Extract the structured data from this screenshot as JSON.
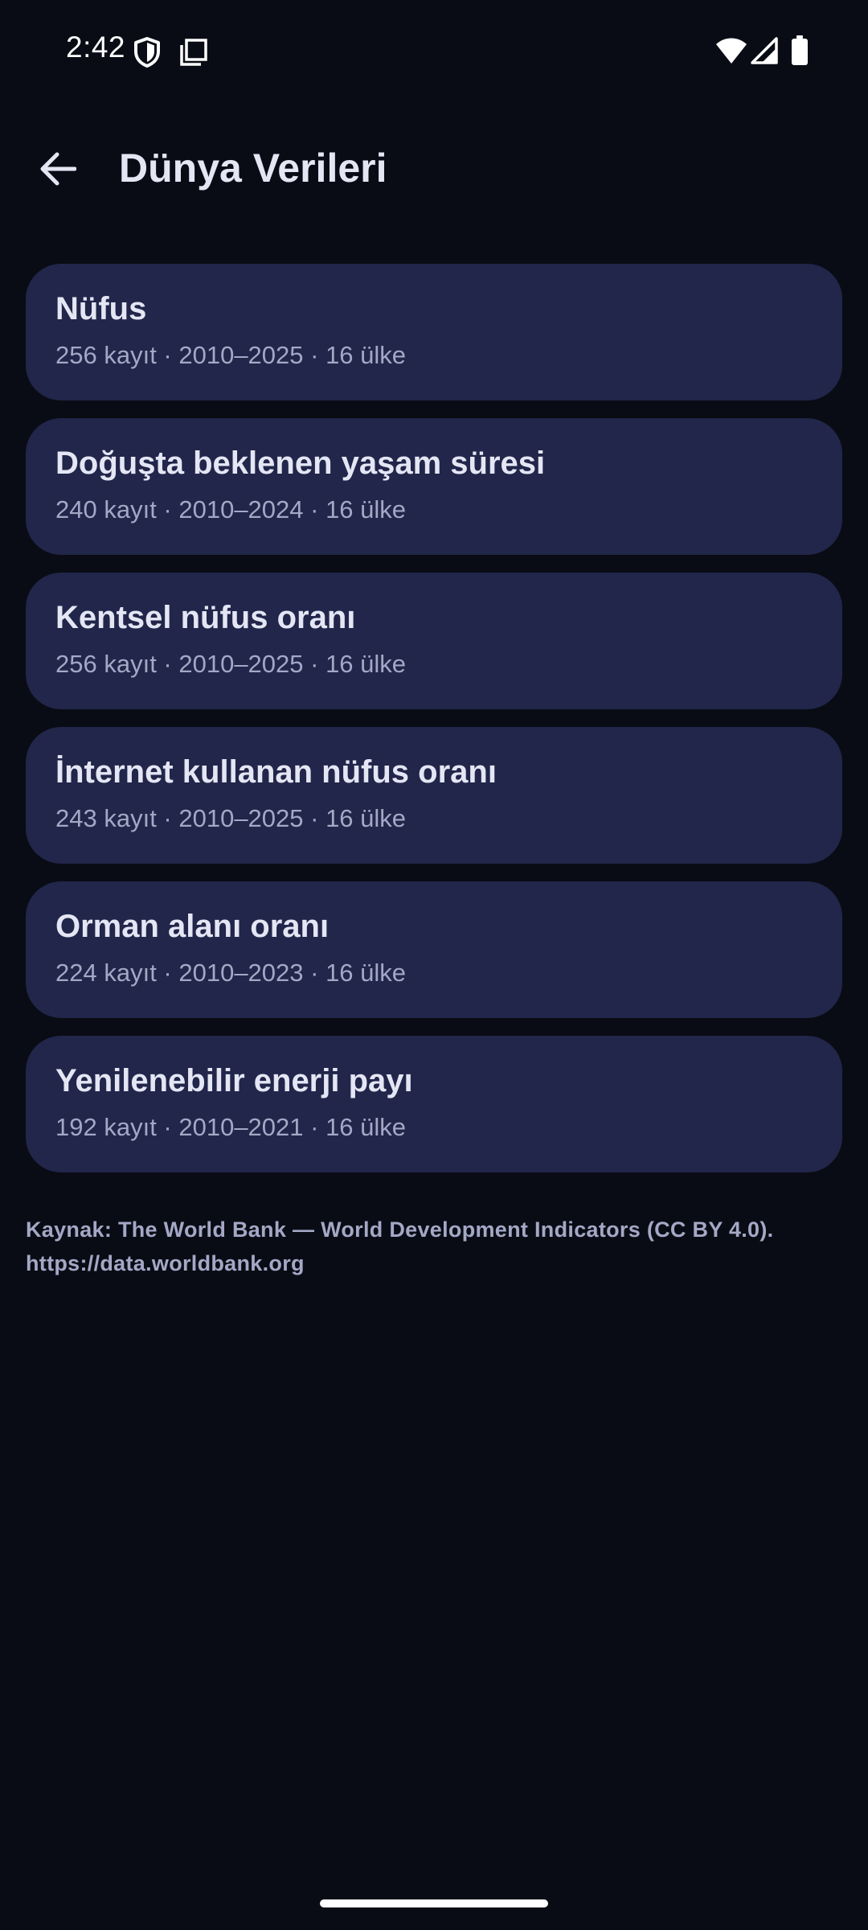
{
  "status_bar": {
    "time": "2:42",
    "icons": [
      "shield-icon",
      "screenshot-icon",
      "wifi-icon",
      "signal-icon",
      "battery-icon"
    ]
  },
  "app_bar": {
    "back_icon": "arrow-left-icon",
    "title": "Dünya Verileri"
  },
  "datasets": [
    {
      "title": "Nüfus",
      "meta": "256 kayıt · 2010–2025 · 16 ülke"
    },
    {
      "title": "Doğuşta beklenen yaşam süresi",
      "meta": "240 kayıt · 2010–2024 · 16 ülke"
    },
    {
      "title": "Kentsel nüfus oranı",
      "meta": "256 kayıt · 2010–2025 · 16 ülke"
    },
    {
      "title": "İnternet kullanan nüfus oranı",
      "meta": "243 kayıt · 2010–2025 · 16 ülke"
    },
    {
      "title": "Orman alanı oranı",
      "meta": "224 kayıt · 2010–2023 · 16 ülke"
    },
    {
      "title": "Yenilenebilir enerji payı",
      "meta": "192 kayıt · 2010–2021 · 16 ülke"
    }
  ],
  "footer": {
    "source_line1": "Kaynak: The World Bank — World Development Indicators (CC BY 4.0).",
    "source_line2": "https://data.worldbank.org"
  },
  "colors": {
    "background": "#0a0c15",
    "card": "#21264a",
    "title_text": "#e4e6f4",
    "secondary_text": "#a4a8c6"
  }
}
